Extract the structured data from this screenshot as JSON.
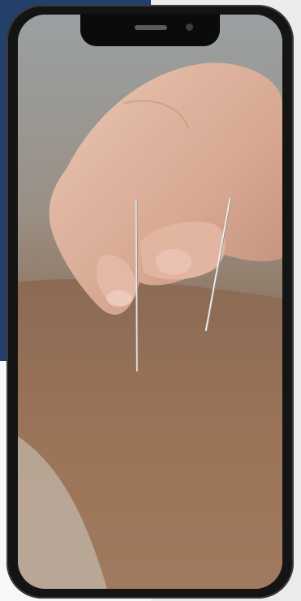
{
  "device": {
    "type": "smartphone",
    "icons": [
      "speaker-grille-icon",
      "front-camera-icon"
    ]
  },
  "colors": {
    "background_navy": "#23406b",
    "background_gray": "#ececec",
    "device_frame": "#141414"
  }
}
